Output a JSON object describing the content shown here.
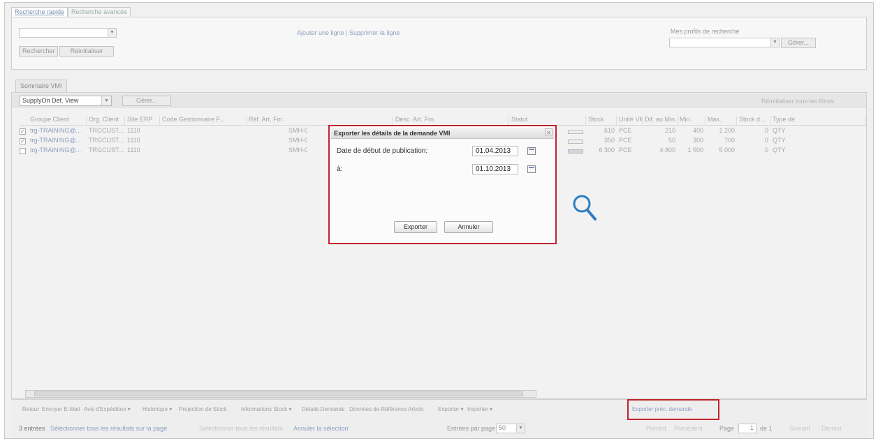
{
  "top_tabs": [
    "Recherche rapide",
    "Recherche avancée"
  ],
  "search": {
    "filter_links": "Ajouter une ligne | Supprimer la ligne",
    "search_button": "Rechercher",
    "reset_button": "Réinitialiser",
    "profiles_label": "Mes profils de recherche",
    "manage_button": "Gérer..."
  },
  "grid": {
    "tab_label": "Sommaire VMI",
    "view_select": "SupplyOn Def. View",
    "manage_button": "Gérer...",
    "show_all_filters": "Réinitialiser tous les filtres",
    "columns": [
      "Groupe Client",
      "Org. Client",
      "Site ERP",
      "Code Gestionnaire F...",
      "Réf. Art. Frn.",
      "Desc. Art. Frn.",
      "Statut",
      "Stock",
      "Unité VMI",
      "Dif. au Min.",
      "Min.",
      "Max.",
      "Stock d...",
      "Type de"
    ],
    "rows": [
      {
        "checked": true,
        "groupe": "trg-TRAINING@...",
        "org": "TRGCUST...",
        "site": "1110",
        "ref": "SMH-00",
        "stock": "610",
        "unite": "PCE",
        "dif": "210",
        "min": "400",
        "max": "1 200",
        "stockd": "0",
        "type": "QTY"
      },
      {
        "checked": true,
        "groupe": "trg-TRAINING@...",
        "org": "TRGCUST...",
        "site": "1110",
        "ref": "SMH-00",
        "stock": "350",
        "unite": "PCE",
        "dif": "50",
        "min": "300",
        "max": "700",
        "stockd": "0",
        "type": "QTY"
      },
      {
        "checked": false,
        "groupe": "trg-TRAINING@...",
        "org": "TRGCUST...",
        "site": "1110",
        "ref": "SMH-00",
        "stock": "6 300",
        "unite": "PCE",
        "dif": "4 800",
        "min": "1 500",
        "max": "5 000",
        "stockd": "0",
        "type": "QTY"
      }
    ]
  },
  "actions": [
    "Retour",
    "Envoyer E-Mail",
    "Avis d'Expédition ▾",
    "Historique ▾",
    "Projection de Stock",
    "Informations Stock ▾",
    "Détails Demande",
    "Données de Référence Article",
    "Exporter ▾",
    "Importer ▾",
    "Exporter préc. demande"
  ],
  "footer": {
    "entries": "3 entrées",
    "select_all_page": "Sélectionner tous les résultats sur la page",
    "select_all": "Sélectionner tous les résultats",
    "cancel_selection": "Annuler la sélection",
    "per_page_label": "Entrées par page",
    "per_page_value": "50",
    "previous": "Précéd.",
    "next_prev": "Précédent",
    "page_label": "Page",
    "page_value": "1",
    "of_label": "de 1",
    "next": "Suivant",
    "last": "Dernier"
  },
  "dialog": {
    "title": "Exporter les détails de la demande VMI",
    "close": "×",
    "start_label": "Date de début de publication:",
    "start_value": "01.04.2013",
    "end_label": "à:",
    "end_value": "01.10.2013",
    "export_button": "Exporter",
    "cancel_button": "Annuler"
  },
  "colors": {
    "highlight": "#c0242c",
    "zoom_icon": "#2e7cc2"
  }
}
